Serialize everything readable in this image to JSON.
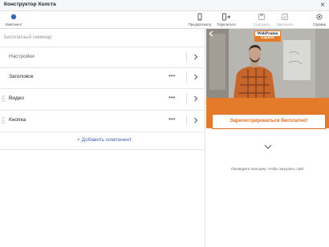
{
  "window": {
    "title": "Конструктор Холста",
    "close_icon": "×"
  },
  "toolbar": {
    "component_label": "Компонент",
    "preview_label": "Предпросмотр",
    "share_label": "Поделиться",
    "save_label": "Сохранить",
    "finish_label": "Завершить",
    "help_label": "Справка",
    "accent": "#4267b2"
  },
  "editor": {
    "document_name": "Бесплатный семинар",
    "rows": [
      {
        "label": "Настройки"
      },
      {
        "label": "Заголовок"
      },
      {
        "label": "Видео"
      },
      {
        "label": "Кнопка"
      }
    ],
    "more_glyph": "•••",
    "add_component": "+ Добавить компонент"
  },
  "preview": {
    "back_glyph": "‹",
    "logo_line1": "WebPromo",
    "logo_line2": "Experts",
    "cta_label": "Зарегистрироваться бесплатно!",
    "swipe_hint": "Проведите пальцем, чтобы загрузить сайт",
    "brand_orange": "#e47b2b"
  }
}
